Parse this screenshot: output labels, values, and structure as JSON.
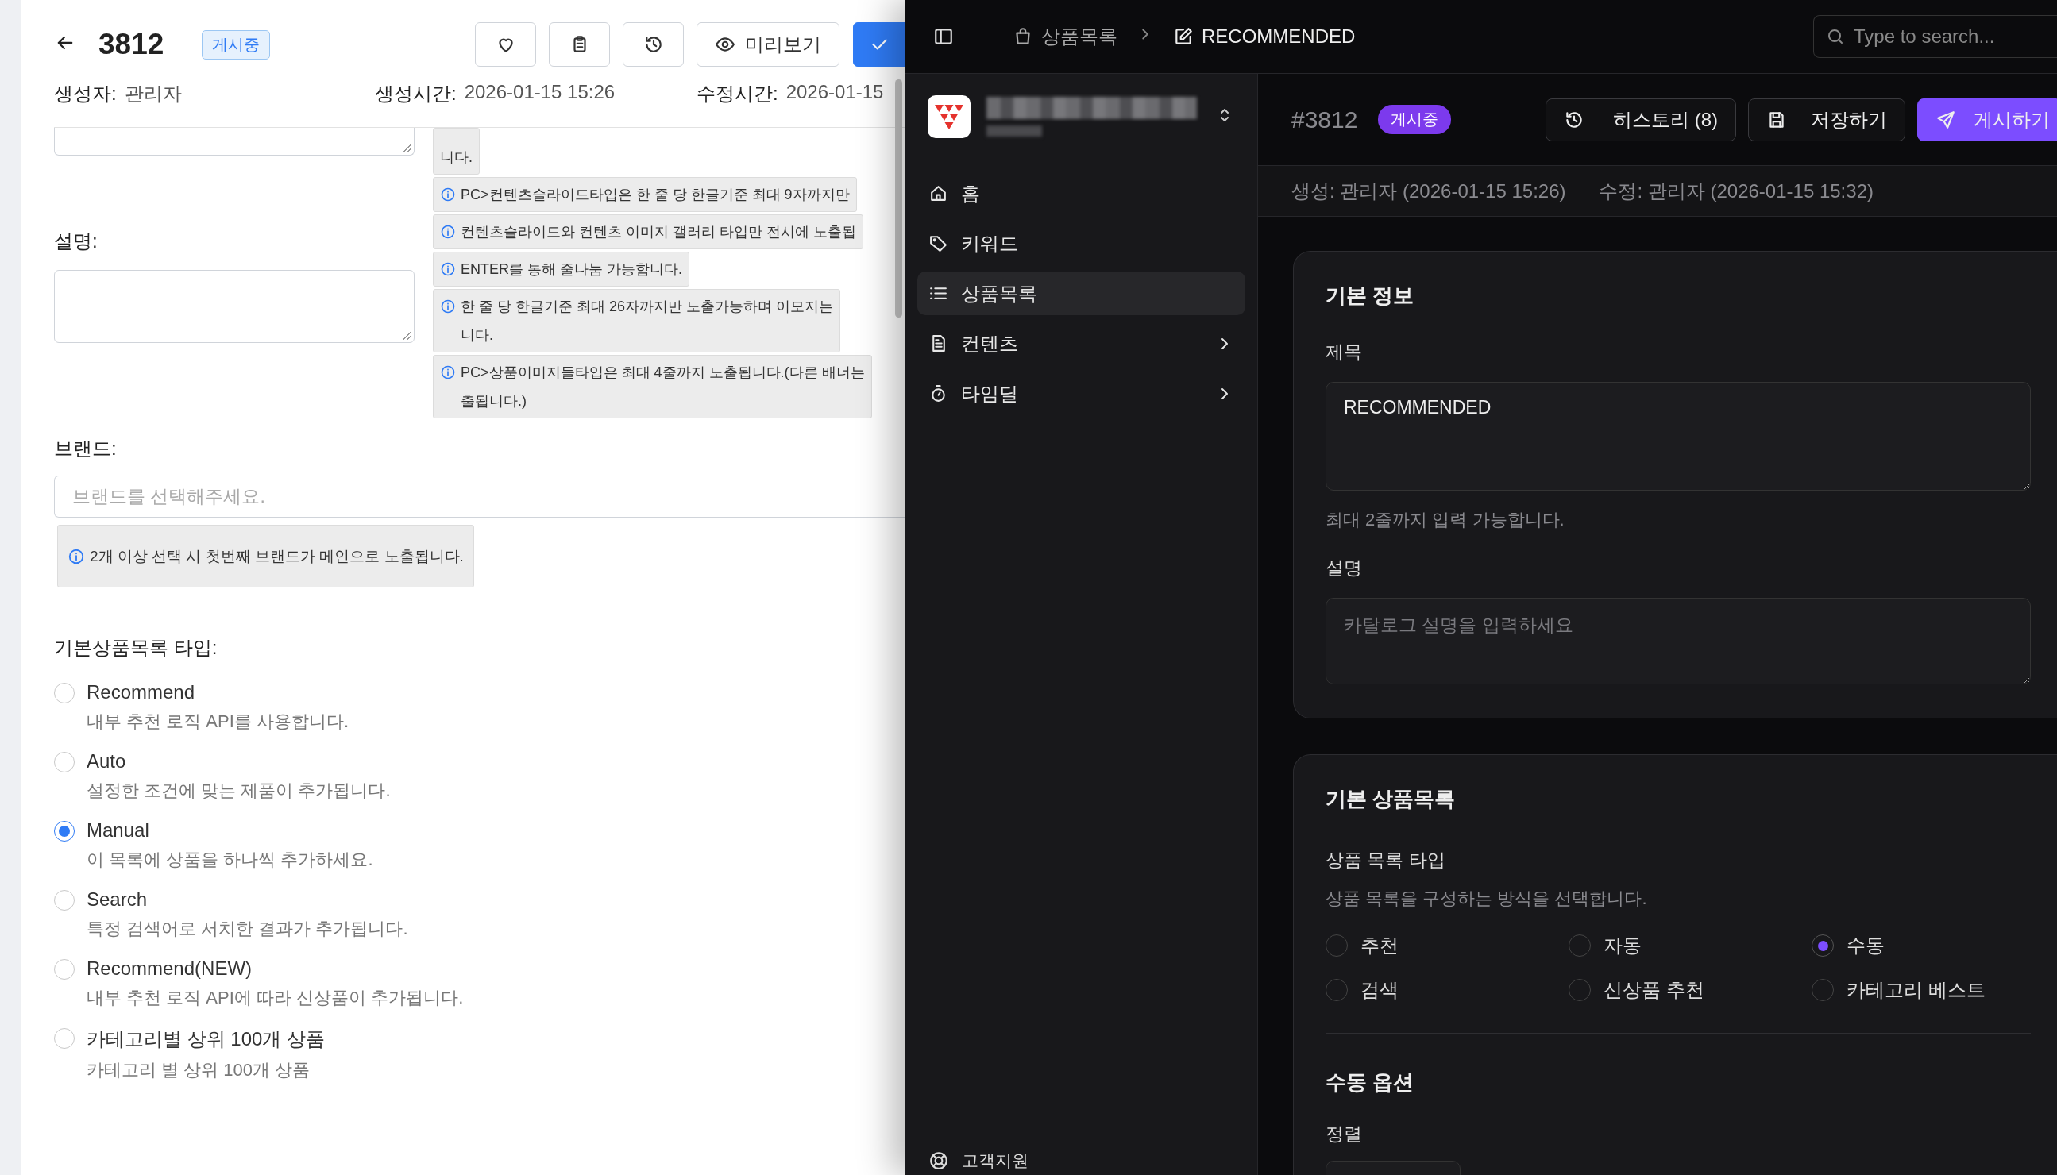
{
  "left_panel": {
    "header": {
      "id": "3812",
      "status_badge": "게시중",
      "buttons": [
        {
          "kind": "heart"
        },
        {
          "kind": "clipboard"
        },
        {
          "kind": "history"
        },
        {
          "kind": "preview",
          "label": "미리보기"
        },
        {
          "kind": "confirm"
        }
      ]
    },
    "meta": [
      {
        "label": "생성자:",
        "value": "관리자"
      },
      {
        "label": "생성시간:",
        "value": "2026-01-15 15:26"
      },
      {
        "label": "수정시간:",
        "value": "2026-01-15"
      }
    ],
    "notes": [
      {
        "kind": "continued",
        "lines": [
          "니다."
        ]
      },
      {
        "kind": "info",
        "lines": [
          "PC>컨텐츠슬라이드타입은 한 줄 당 한글기준 최대 9자까지만"
        ]
      },
      {
        "kind": "info",
        "lines": [
          "컨텐츠슬라이드와 컨텐츠 이미지 갤러리 타입만 전시에 노출됩"
        ]
      },
      {
        "kind": "info",
        "lines": [
          "ENTER를 통해 줄나눔 가능합니다."
        ]
      },
      {
        "kind": "info",
        "lines": [
          "한 줄 당 한글기준 최대 26자까지만 노출가능하며 이모지는",
          "니다."
        ]
      },
      {
        "kind": "info",
        "lines": [
          "PC>상품이미지들타입은 최대 4줄까지 노출됩니다.(다른 배너는",
          "출됩니다.)"
        ]
      }
    ],
    "description_label": "설명:",
    "brand": {
      "label": "브랜드:",
      "placeholder": "브랜드를 선택해주세요.",
      "note": "2개 이상 선택 시 첫번째 브랜드가 메인으로 노출됩니다."
    },
    "list_type": {
      "label": "기본상품목록 타입:",
      "options": [
        {
          "label": "Recommend",
          "description": "내부 추천 로직 API를 사용합니다.",
          "selected": false
        },
        {
          "label": "Auto",
          "description": "설정한 조건에 맞는 제품이 추가됩니다.",
          "selected": false
        },
        {
          "label": "Manual",
          "description": "이 목록에 상품을 하나씩 추가하세요.",
          "selected": true
        },
        {
          "label": "Search",
          "description": "특정 검색어로 서치한 결과가 추가됩니다.",
          "selected": false
        },
        {
          "label": "Recommend(NEW)",
          "description": "내부 추천 로직 API에 따라 신상품이 추가됩니다.",
          "selected": false
        },
        {
          "label": "카테고리별 상위 100개 상품",
          "description": "카테고리 별 상위 100개 상품",
          "selected": false
        }
      ]
    }
  },
  "right_panel": {
    "breadcrumb": [
      {
        "kind": "bag",
        "label": "상품목록"
      },
      {
        "kind": "edit",
        "label": "RECOMMENDED"
      }
    ],
    "search": {
      "placeholder": "Type to search..."
    },
    "sidebar": {
      "items": [
        {
          "kind": "home",
          "label": "홈",
          "selected": false,
          "expandable": false
        },
        {
          "kind": "tag",
          "label": "키워드",
          "selected": false,
          "expandable": false
        },
        {
          "kind": "list",
          "label": "상품목록",
          "selected": true,
          "expandable": false
        },
        {
          "kind": "document",
          "label": "컨텐츠",
          "selected": false,
          "expandable": true
        },
        {
          "kind": "timer",
          "label": "타임딜",
          "selected": false,
          "expandable": true
        }
      ],
      "footer": "고객지원"
    },
    "header": {
      "id": "#3812",
      "status_badge": "게시중",
      "buttons": [
        {
          "kind": "history",
          "label": "히스토리 (8)"
        },
        {
          "kind": "save",
          "label": "저장하기"
        },
        {
          "kind": "publish",
          "label": "게시하기"
        }
      ]
    },
    "meta": [
      "생성: 관리자 (2026-01-15 15:26)",
      "수정: 관리자 (2026-01-15 15:32)"
    ],
    "basic_info": {
      "title": "기본 정보",
      "title_label": "제목",
      "title_value": "RECOMMENDED",
      "title_hint": "최대 2줄까지 입력 가능합니다.",
      "description_label": "설명",
      "description_placeholder": "카탈로그 설명을 입력하세요"
    },
    "list_card": {
      "title": "기본 상품목록",
      "type_label": "상품 목록 타입",
      "type_hint": "상품 목록을 구성하는 방식을 선택합니다.",
      "options": [
        {
          "label": "추천",
          "selected": false
        },
        {
          "label": "자동",
          "selected": false
        },
        {
          "label": "수동",
          "selected": true
        },
        {
          "label": "검색",
          "selected": false
        },
        {
          "label": "신상품 추천",
          "selected": false
        },
        {
          "label": "카테고리 베스트",
          "selected": false
        }
      ],
      "manual_title": "수동 옵션",
      "sort_label": "정렬"
    }
  }
}
